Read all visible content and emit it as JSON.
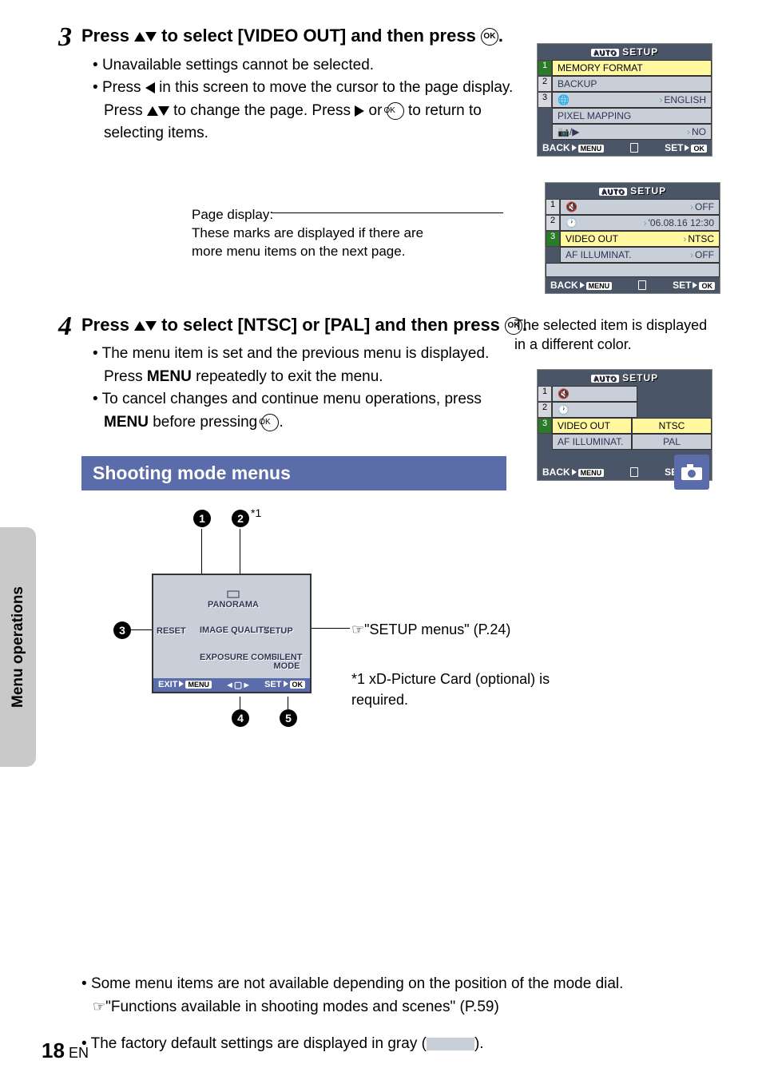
{
  "step3": {
    "num": "3",
    "title_pre": "Press ",
    "title_mid": " to select [VIDEO OUT] and then press ",
    "title_end": ".",
    "b1": "Unavailable settings cannot be selected.",
    "b2a": "Press ",
    "b2b": " in this screen to move the cursor to the page display.  Press ",
    "b2c": " to change the page. Press ",
    "b2d": " or ",
    "b2e": " to return to selecting items."
  },
  "page_display_note": {
    "l1": "Page display:",
    "l2": "These marks are displayed if there are more menu items on the next page."
  },
  "selected_caption": "The selected item is displayed in a different color.",
  "step4": {
    "num": "4",
    "title_pre": "Press ",
    "title_mid": " to select [NTSC] or [PAL] and then press ",
    "title_end": ".",
    "b1a": "The menu item is set and the previous menu is displayed. Press ",
    "b1_menu": "MENU",
    "b1b": " repeatedly to exit the menu.",
    "b2a": "To cancel changes and continue menu operations, press ",
    "b2_menu": "MENU",
    "b2b": " before pressing ",
    "b2c": "."
  },
  "cam_common": {
    "auto": "AUTO",
    "setup": "SETUP",
    "back": "BACK",
    "menu": "MENU",
    "set": "SET",
    "ok": "OK"
  },
  "cam1": {
    "r1": "MEMORY FORMAT",
    "r2": "BACKUP",
    "r3_label": "",
    "r3_val": "ENGLISH",
    "r4": "PIXEL MAPPING",
    "r5_val": "NO"
  },
  "cam2": {
    "r1_val": "OFF",
    "r2_val": "'06.08.16 12:30",
    "r3_label": "VIDEO OUT",
    "r3_val": "NTSC",
    "r4_label": "AF ILLUMINAT.",
    "r4_val": "OFF"
  },
  "cam3": {
    "r3_label": "VIDEO OUT",
    "r3_val": "NTSC",
    "r4_label": "AF ILLUMINAT.",
    "r4_val": "PAL"
  },
  "section_title": "Shooting mode menus",
  "diagram": {
    "panorama": "PANORAMA",
    "reset": "RESET",
    "image_quality": "IMAGE QUALITY",
    "setup": "SETUP",
    "exposure": "EXPOSURE COMP.",
    "silent": "SILENT MODE",
    "exit": "EXIT",
    "set": "SET",
    "ok": "OK",
    "menu": "MENU",
    "sup": "*1",
    "note1": "\"SETUP menus\" (P.24)",
    "note2": "*1 xD-Picture Card (optional) is required."
  },
  "bottom": {
    "n1a": "Some menu items are not available depending on the position of the mode dial.",
    "n1b": "\"Functions available in shooting modes and scenes\" (P.59)",
    "n2a": "The factory default settings are displayed in gray (",
    "n2b": ")."
  },
  "side_tab": "Menu operations",
  "page": {
    "num": "18",
    "lang": "EN"
  }
}
